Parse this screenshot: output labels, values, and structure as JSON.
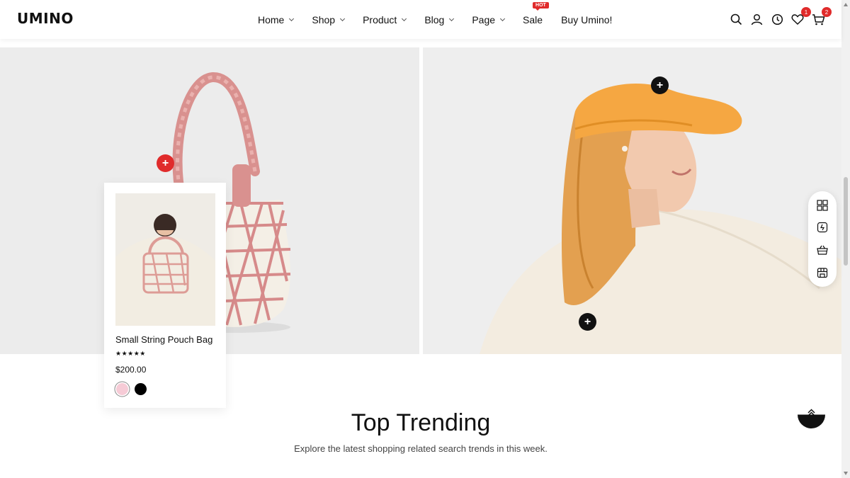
{
  "header": {
    "logo": "UMINO",
    "nav": [
      {
        "label": "Home",
        "dropdown": true
      },
      {
        "label": "Shop",
        "dropdown": true
      },
      {
        "label": "Product",
        "dropdown": true
      },
      {
        "label": "Blog",
        "dropdown": true
      },
      {
        "label": "Page",
        "dropdown": true
      },
      {
        "label": "Sale",
        "dropdown": false,
        "badge": "HOT"
      },
      {
        "label": "Buy Umino!",
        "dropdown": false
      }
    ],
    "icons": [
      "search-icon",
      "account-icon",
      "history-icon",
      "wishlist-icon",
      "cart-icon"
    ],
    "wishlist_count": "1",
    "cart_count": "2",
    "accent_color": "#e02b2b"
  },
  "banners": {
    "left_hotspot_color": "#e02b2b",
    "right_hotspot_color": "#111111"
  },
  "popup_product": {
    "name": "Small String Pouch Bag",
    "rating": "★★★★★",
    "price": "$200.00",
    "swatches": [
      "#f6cbd6",
      "#000000"
    ]
  },
  "side_tools": [
    "grid-icon",
    "compare-icon",
    "basket-icon",
    "store-icon"
  ],
  "section": {
    "title": "Top Trending",
    "subtitle": "Explore the latest shopping related search trends in this week."
  }
}
